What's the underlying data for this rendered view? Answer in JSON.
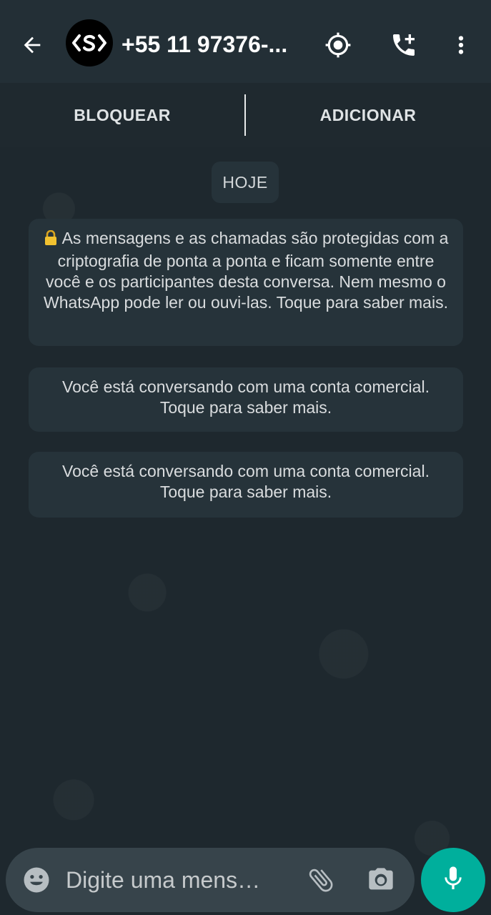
{
  "header": {
    "contact_name": "+55 11 97376-...",
    "avatar_label": "‹$›",
    "icons": [
      "back-arrow-icon",
      "location-target-icon",
      "add-call-icon",
      "more-vert-icon"
    ]
  },
  "actions": {
    "block_label": "BLOQUEAR",
    "add_label": "ADICIONAR"
  },
  "chat": {
    "date_chip": "HOJE",
    "encryption_notice": "As mensagens e as chamadas são protegidas com a criptografia de ponta a ponta e ficam somente entre você e os participantes desta conversa. Nem mesmo o WhatsApp pode ler ou ouvi-las. Toque para saber mais.",
    "business_notice_1": "Você está conversando com uma conta comercial. Toque para saber mais.",
    "business_notice_2": "Você está conversando com uma conta comercial. Toque para saber mais."
  },
  "composer": {
    "placeholder": "Digite uma mens…"
  },
  "colors": {
    "header_bg": "#232f36",
    "chat_bg": "#1e282e",
    "bubble_bg": "#26333a",
    "accent": "#00af9c"
  }
}
